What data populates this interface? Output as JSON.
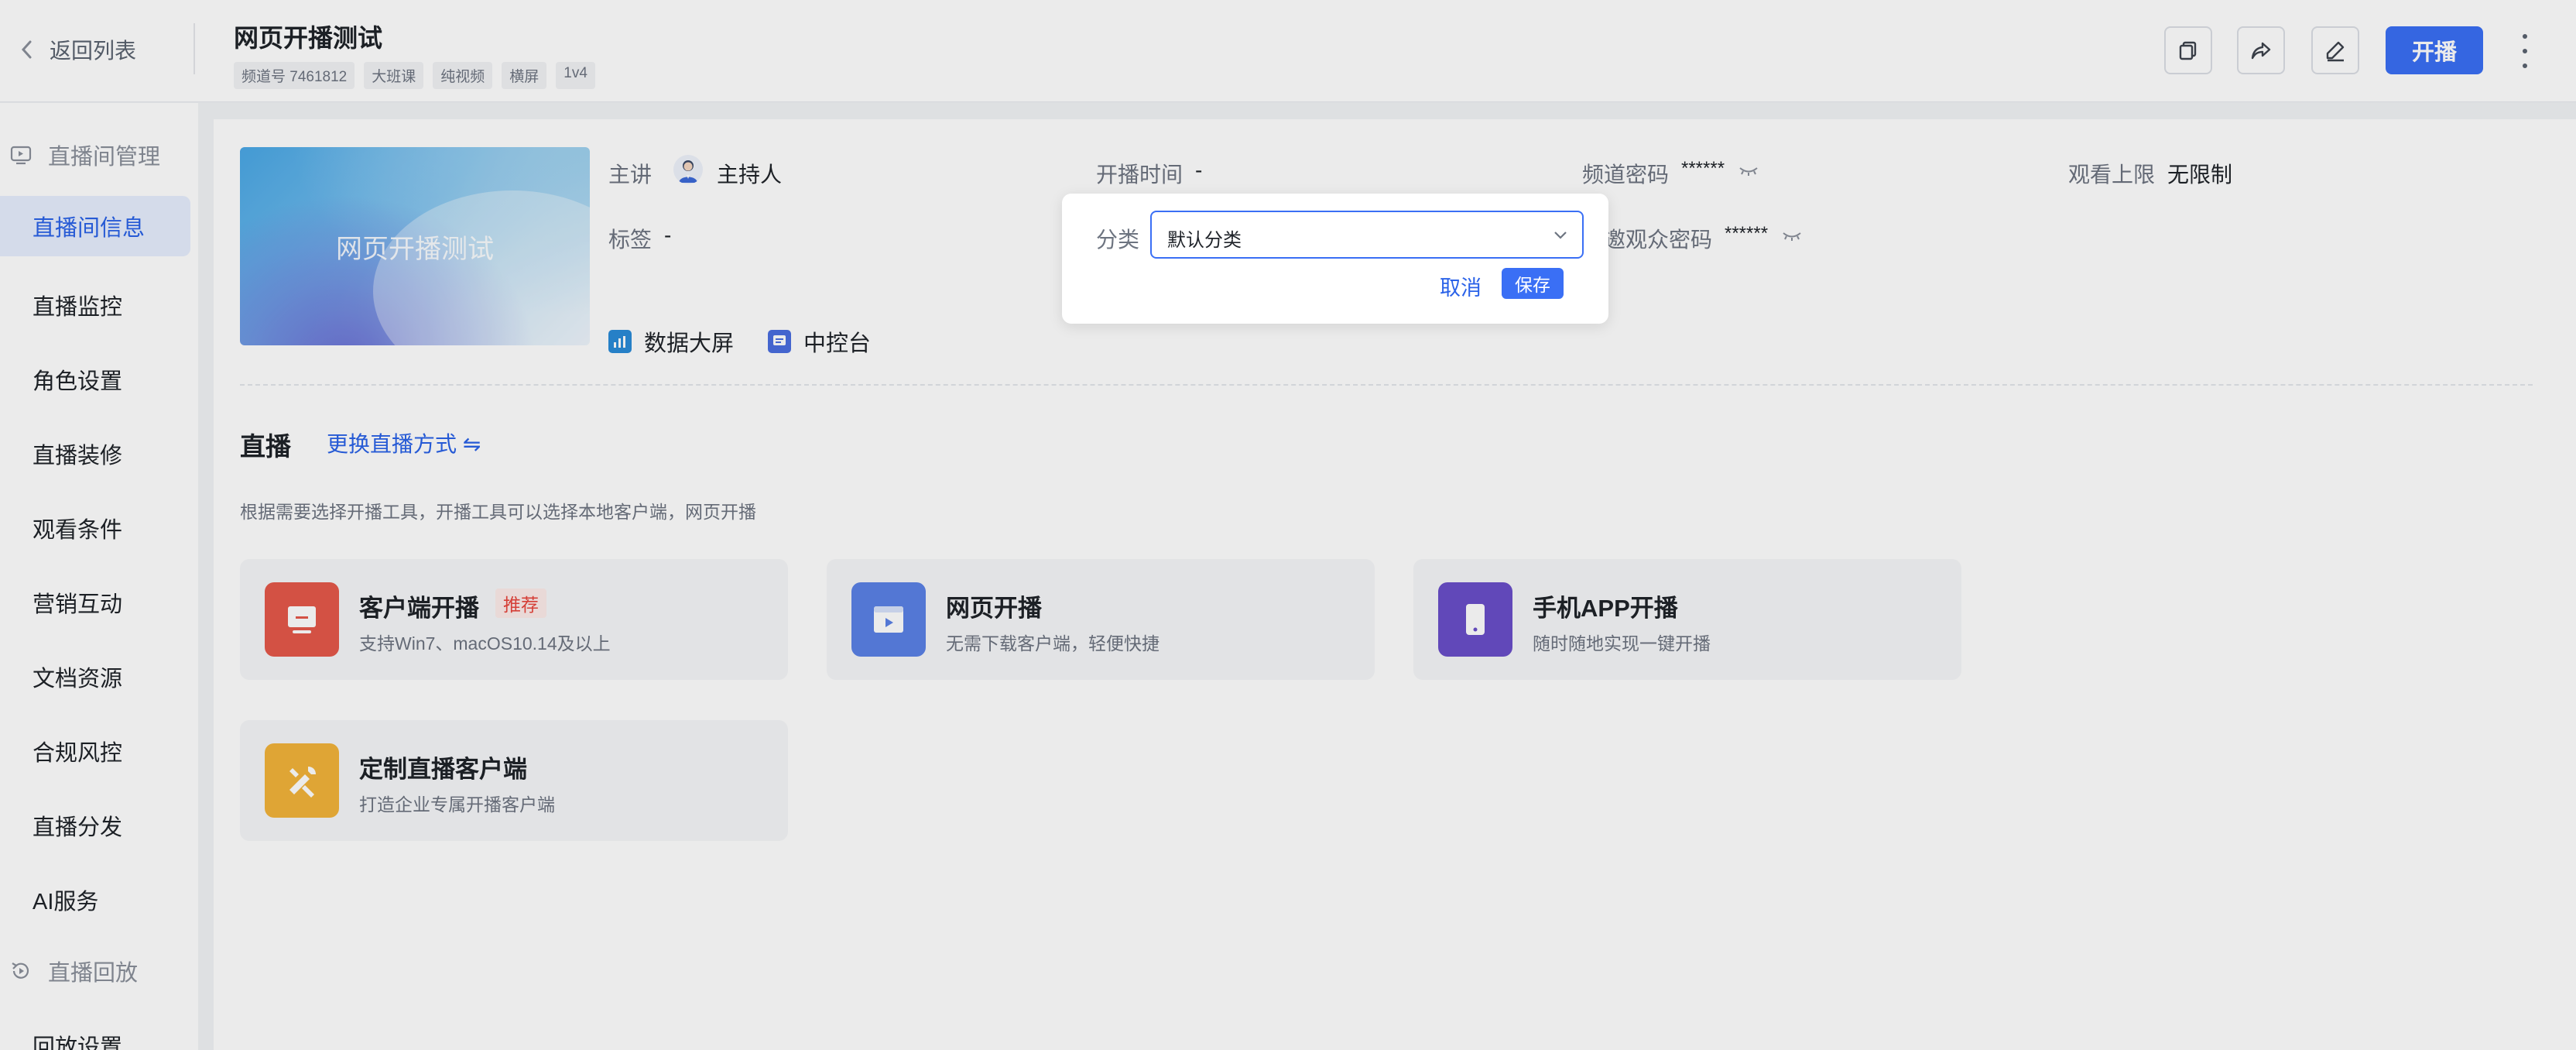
{
  "header": {
    "back_label": "返回列表",
    "title": "网页开播测试",
    "tags": [
      "频道号 7461812",
      "大班课",
      "纯视频",
      "横屏",
      "1v4"
    ],
    "start_label": "开播"
  },
  "sidebar": {
    "group_live": "直播间管理",
    "items": [
      "直播间信息",
      "直播监控",
      "角色设置",
      "直播装修",
      "观看条件",
      "营销互动",
      "文档资源",
      "合规风控",
      "直播分发",
      "AI服务"
    ],
    "group_replay": "直播回放",
    "replay_items": [
      "回放设置"
    ]
  },
  "info": {
    "cover_text": "网页开播测试",
    "speaker_label": "主讲",
    "speaker_value": "主持人",
    "start_time_label": "开播时间",
    "start_time_value": "-",
    "password_label": "频道密码",
    "password_value": "******",
    "limit_label": "观看上限",
    "limit_value": "无限制",
    "tag_label": "标签",
    "tag_value": "-",
    "guest_password_label": "特邀观众密码",
    "guest_password_value": "******",
    "tools": [
      "数据大屏",
      "中控台"
    ]
  },
  "live": {
    "section_title": "直播",
    "switch_label": "更换直播方式 ⇋",
    "description": "根据需要选择开播工具，开播工具可以选择本地客户端，网页开播",
    "cards": [
      {
        "title": "客户端开播",
        "badge": "推荐",
        "subtitle": "支持Win7、macOS10.14及以上"
      },
      {
        "title": "网页开播",
        "subtitle": "无需下载客户端，轻便快捷"
      },
      {
        "title": "手机APP开播",
        "subtitle": "随时随地实现一键开播"
      },
      {
        "title": "定制直播客户端",
        "subtitle": "打造企业专属开播客户端"
      }
    ]
  },
  "popover": {
    "label": "分类",
    "selected": "默认分类",
    "cancel_label": "取消",
    "save_label": "保存"
  },
  "colors": {
    "primary": "#3a6ff5",
    "active_bg": "#e6eefe",
    "badge_red": "#e8453c"
  }
}
